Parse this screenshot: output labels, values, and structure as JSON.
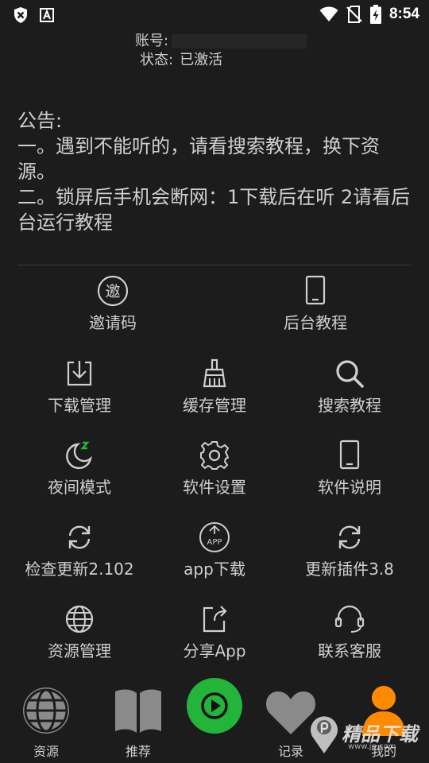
{
  "status_bar": {
    "time": "8:54",
    "left_icons": [
      "shield-x-icon",
      "font-a-icon"
    ],
    "right_icons": [
      "wifi-icon",
      "no-sim-icon",
      "battery-charging-icon"
    ]
  },
  "account": {
    "account_label": "账号:",
    "status_label": "状态:",
    "status_value": "已激活"
  },
  "notice": {
    "title": "公告:",
    "line1": "一。遇到不能听的，请看搜索教程，换下资源。",
    "line2": "二。锁屏后手机会断网：1下载后在听 2请看后台运行教程"
  },
  "menu": {
    "invite": "邀请码",
    "background_tutorial": "后台教程",
    "download_manage": "下载管理",
    "cache_manage": "缓存管理",
    "search_tutorial": "搜索教程",
    "night_mode": "夜间模式",
    "software_settings": "软件设置",
    "software_info": "软件说明",
    "check_update": "检查更新2.102",
    "app_download": "app下载",
    "update_plugin": "更新插件3.8",
    "resource_manage": "资源管理",
    "share_app": "分享App",
    "contact_service": "联系客服",
    "invite_glyph": "邀",
    "app_glyph": "APP"
  },
  "bottom_nav": {
    "resources": "资源",
    "recommend": "推荐",
    "records": "记录",
    "mine": "我的"
  },
  "watermark": {
    "text": "精品下载",
    "url": "www.jp.com"
  },
  "colors": {
    "background": "#1c1c1c",
    "text": "#cfcfcf",
    "play_green": "#22b53a",
    "active_orange": "#ff8a00",
    "nav_gray": "#8a8a8a"
  }
}
